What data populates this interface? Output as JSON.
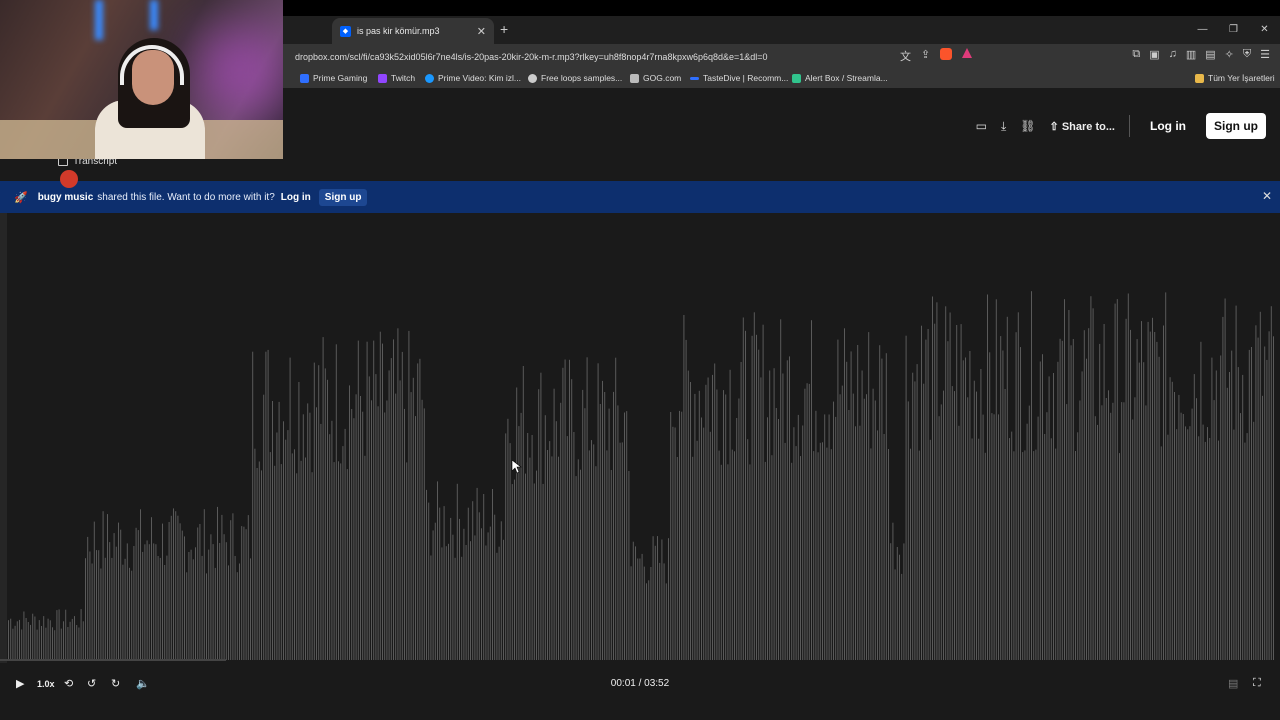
{
  "browser": {
    "tab_title": "is pas kir kömür.mp3",
    "tab_favicon": "dropbox-icon",
    "url": "dropbox.com/scl/fi/ca93k52xid05l6r7ne4ls/is-20pas-20kir-20k-m-r.mp3?rlkey=uh8f8nop4r7rna8kpxw6p6q8d&e=1&dl=0",
    "bookmarks": [
      {
        "label": "Prime Gaming",
        "color": "#2f6fff"
      },
      {
        "label": "Twitch",
        "color": "#9146ff"
      },
      {
        "label": "Prime Video: Kim izl...",
        "color": "#1a98ff"
      },
      {
        "label": "Free loops samples...",
        "color": "#cccccc"
      },
      {
        "label": "GOG.com",
        "color": "#bbbbbb"
      },
      {
        "label": "TasteDive | Recomm...",
        "color": "#2f6fff"
      },
      {
        "label": "Alert Box / Streamla...",
        "color": "#31c48d"
      }
    ],
    "all_bookmarks": "Tüm Yer İşaretleri"
  },
  "header": {
    "share_label": "Share to...",
    "login_label": "Log in",
    "signup_label": "Sign up"
  },
  "transcript_label": "Transcript",
  "banner": {
    "user": "bugy music",
    "message": "shared this file. Want to do more with it?",
    "login_label": "Log in",
    "signup_label": "Sign up"
  },
  "player": {
    "speed": "1.0x",
    "time": "00:01 / 03:52",
    "rewind_label": "10",
    "forward_label": "10",
    "progress": 0.004
  },
  "colors": {
    "banner_bg": "#0d2f6e",
    "page_bg": "#1a1a1a",
    "wave_color": "#5a5a5a"
  }
}
